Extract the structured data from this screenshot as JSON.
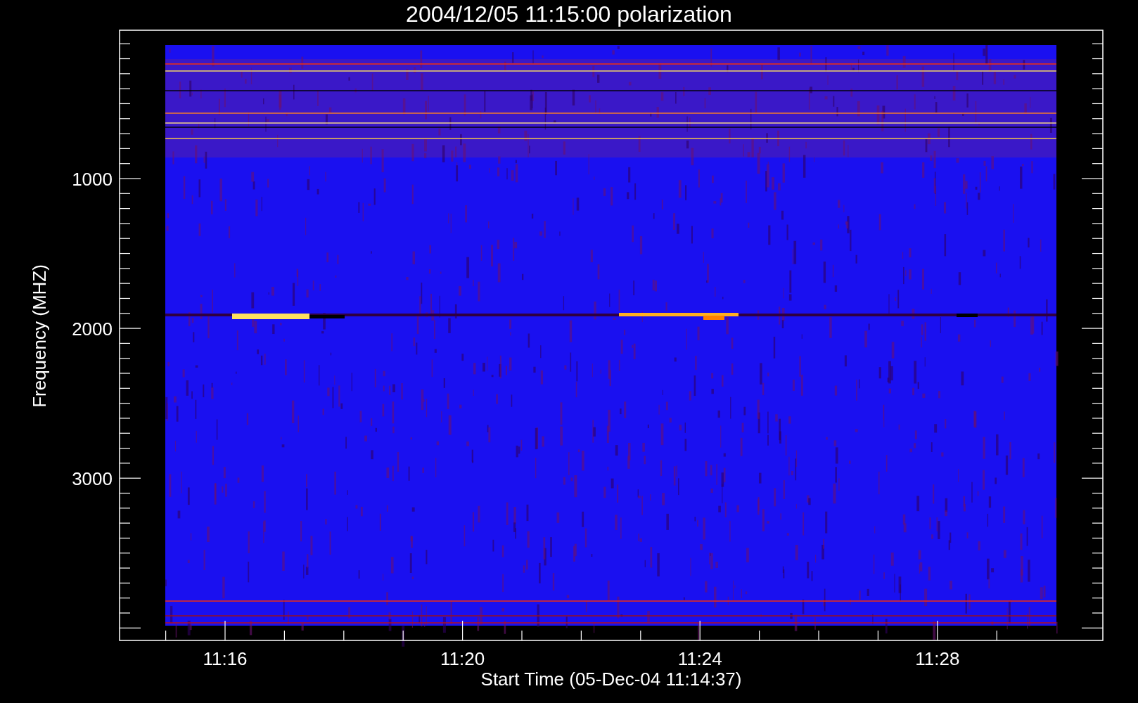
{
  "title": "2004/12/05 11:15:00 polarization",
  "y_axis": {
    "label": "Frequency (MHZ)",
    "ticks": [
      "1000",
      "2000",
      "3000"
    ]
  },
  "x_axis": {
    "label": "Start Time (05-Dec-04 11:14:37)",
    "ticks": [
      "11:16",
      "11:20",
      "11:24",
      "11:28"
    ]
  }
}
